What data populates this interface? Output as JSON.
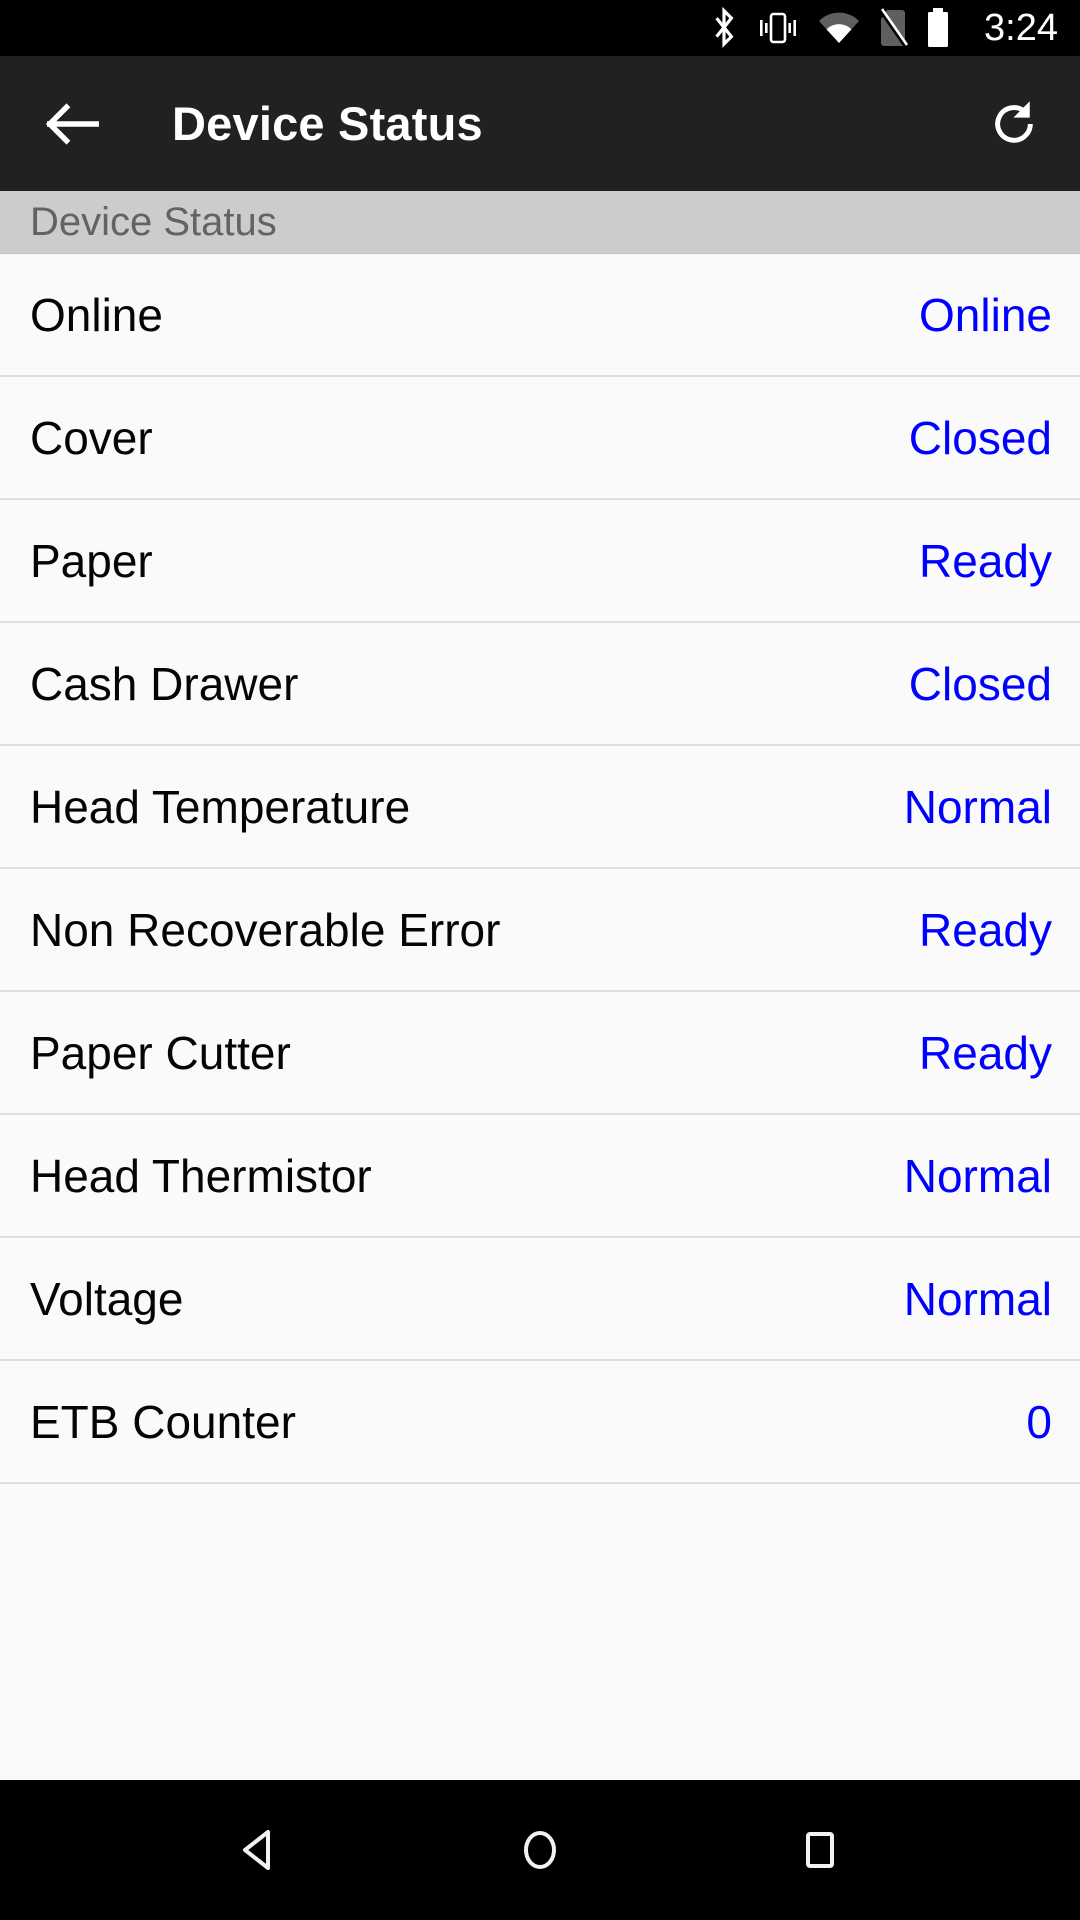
{
  "status_bar": {
    "time": "3:24",
    "icons": [
      "bluetooth-icon",
      "vibrate-icon",
      "wifi-icon",
      "no-sim-icon",
      "battery-full-icon"
    ]
  },
  "toolbar": {
    "back_label": "back-arrow-icon",
    "title": "Device Status",
    "refresh_label": "refresh-icon",
    "background_color": "#212121"
  },
  "section": {
    "header": "Device Status",
    "header_bg": "#cccccc",
    "header_color": "#636363"
  },
  "list": {
    "value_color": "#0000ff",
    "label_color": "#050505",
    "rows": [
      {
        "label": "Online",
        "value": "Online"
      },
      {
        "label": "Cover",
        "value": "Closed"
      },
      {
        "label": "Paper",
        "value": "Ready"
      },
      {
        "label": "Cash Drawer",
        "value": "Closed"
      },
      {
        "label": "Head Temperature",
        "value": "Normal"
      },
      {
        "label": "Non Recoverable Error",
        "value": "Ready"
      },
      {
        "label": "Paper Cutter",
        "value": "Ready"
      },
      {
        "label": "Head Thermistor",
        "value": "Normal"
      },
      {
        "label": "Voltage",
        "value": "Normal"
      },
      {
        "label": "ETB Counter",
        "value": "0"
      }
    ]
  },
  "nav_bar": {
    "back": "nav-back-icon",
    "home": "nav-home-icon",
    "recents": "nav-recents-icon"
  }
}
